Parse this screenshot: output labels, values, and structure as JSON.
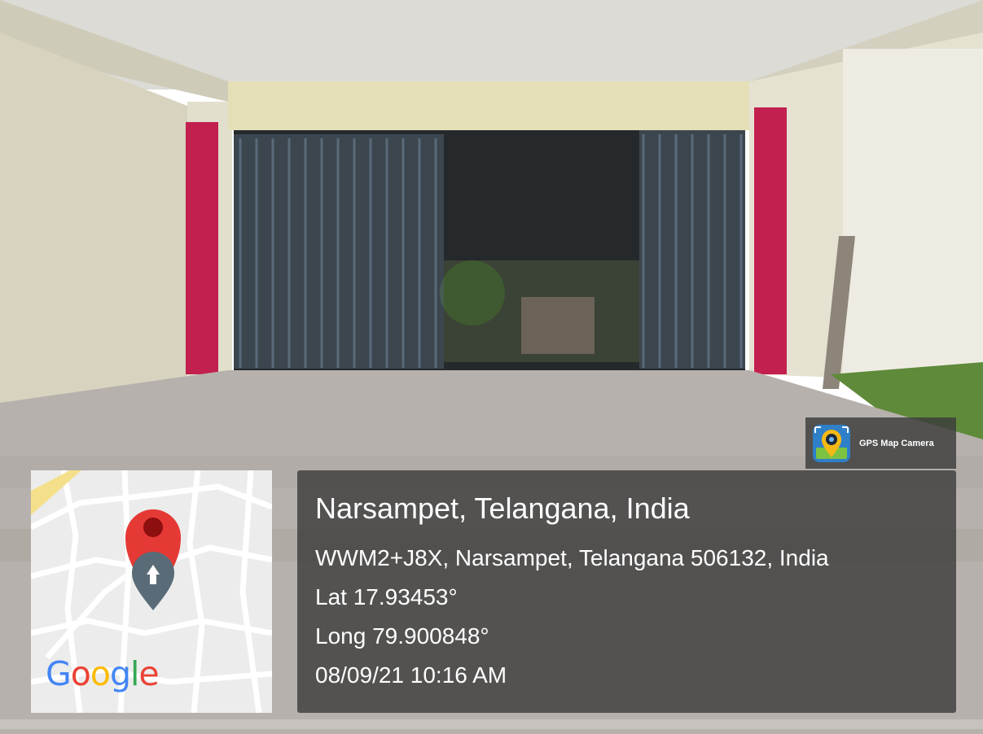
{
  "location": {
    "title": "Narsampet, Telangana, India",
    "address": "WWM2+J8X, Narsampet, Telangana 506132, India",
    "latitude": "Lat 17.93453°",
    "longitude": "Long 79.900848°",
    "datetime": "08/09/21 10:16 AM"
  },
  "badge": {
    "label": "GPS Map Camera",
    "icon": "gps-map-camera-icon"
  },
  "map": {
    "logo_letters": [
      {
        "char": "G",
        "color": "#4285F4"
      },
      {
        "char": "o",
        "color": "#EA4335"
      },
      {
        "char": "o",
        "color": "#FBBC05"
      },
      {
        "char": "g",
        "color": "#4285F4"
      },
      {
        "char": "l",
        "color": "#34A853"
      },
      {
        "char": "e",
        "color": "#EA4335"
      }
    ],
    "pin_color": "#E53935",
    "marker_icon": "location-pin-icon"
  },
  "colors": {
    "wall": "#d9d6c4",
    "pillar": "#c2204f",
    "gate": "#4f5f6e",
    "floor": "#b7b1ad",
    "grass": "#5f8a3a"
  }
}
